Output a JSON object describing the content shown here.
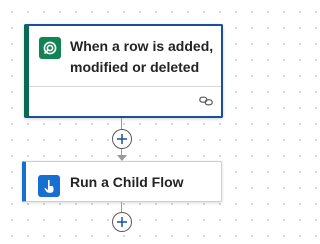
{
  "trigger": {
    "title": "When a row is added, modified or deleted",
    "icon": "dataverse-icon",
    "footer_icon": "link-icon",
    "accent_color": "#0b6a52",
    "border_color": "#1b4f9c"
  },
  "add_step": {
    "icon": "plus-icon"
  },
  "action": {
    "title": "Run a Child Flow",
    "icon": "child-flow-icon",
    "accent_color": "#1570d1"
  }
}
